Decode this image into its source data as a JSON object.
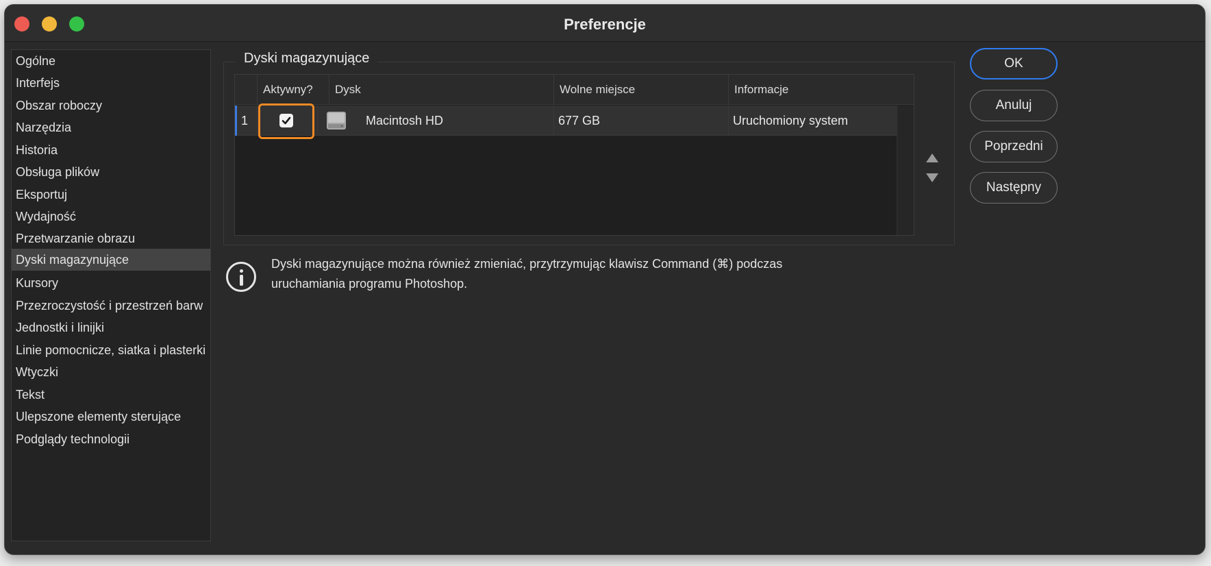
{
  "window": {
    "title": "Preferencje"
  },
  "sidebar": {
    "items": [
      {
        "label": "Ogólne"
      },
      {
        "label": "Interfejs"
      },
      {
        "label": "Obszar roboczy"
      },
      {
        "label": "Narzędzia"
      },
      {
        "label": "Historia"
      },
      {
        "label": "Obsługa plików"
      },
      {
        "label": "Eksportuj"
      },
      {
        "label": "Wydajność"
      },
      {
        "label": "Przetwarzanie obrazu"
      },
      {
        "label": "Dyski magazynujące"
      },
      {
        "label": "Kursory"
      },
      {
        "label": "Przezroczystość i przestrzeń barw"
      },
      {
        "label": "Jednostki i linijki"
      },
      {
        "label": "Linie pomocnicze, siatka i plasterki"
      },
      {
        "label": "Wtyczki"
      },
      {
        "label": "Tekst"
      },
      {
        "label": "Ulepszone elementy sterujące"
      },
      {
        "label": "Podglądy technologii"
      }
    ],
    "selected": "Dyski magazynujące"
  },
  "scratch": {
    "group_title": "Dyski magazynujące",
    "columns": {
      "active": "Aktywny?",
      "disk": "Dysk",
      "free": "Wolne miejsce",
      "info": "Informacje"
    },
    "rows": [
      {
        "index": "1",
        "active": true,
        "disk": "Macintosh HD",
        "free": "677 GB",
        "info": "Uruchomiony system",
        "icon": "hard-drive-icon"
      }
    ]
  },
  "buttons": {
    "ok": "OK",
    "cancel": "Anuluj",
    "prev": "Poprzedni",
    "next": "Następny"
  },
  "info": {
    "line1": "Dyski magazynujące można również zmieniać, przytrzymując klawisz Command (⌘) podczas",
    "line2": "uruchamiania programu Photoshop."
  },
  "colors": {
    "accent": "#2f7bf0",
    "highlight": "#f08a24",
    "close": "#ee5b53",
    "minimize": "#f2b73a",
    "maximize": "#33c148"
  }
}
